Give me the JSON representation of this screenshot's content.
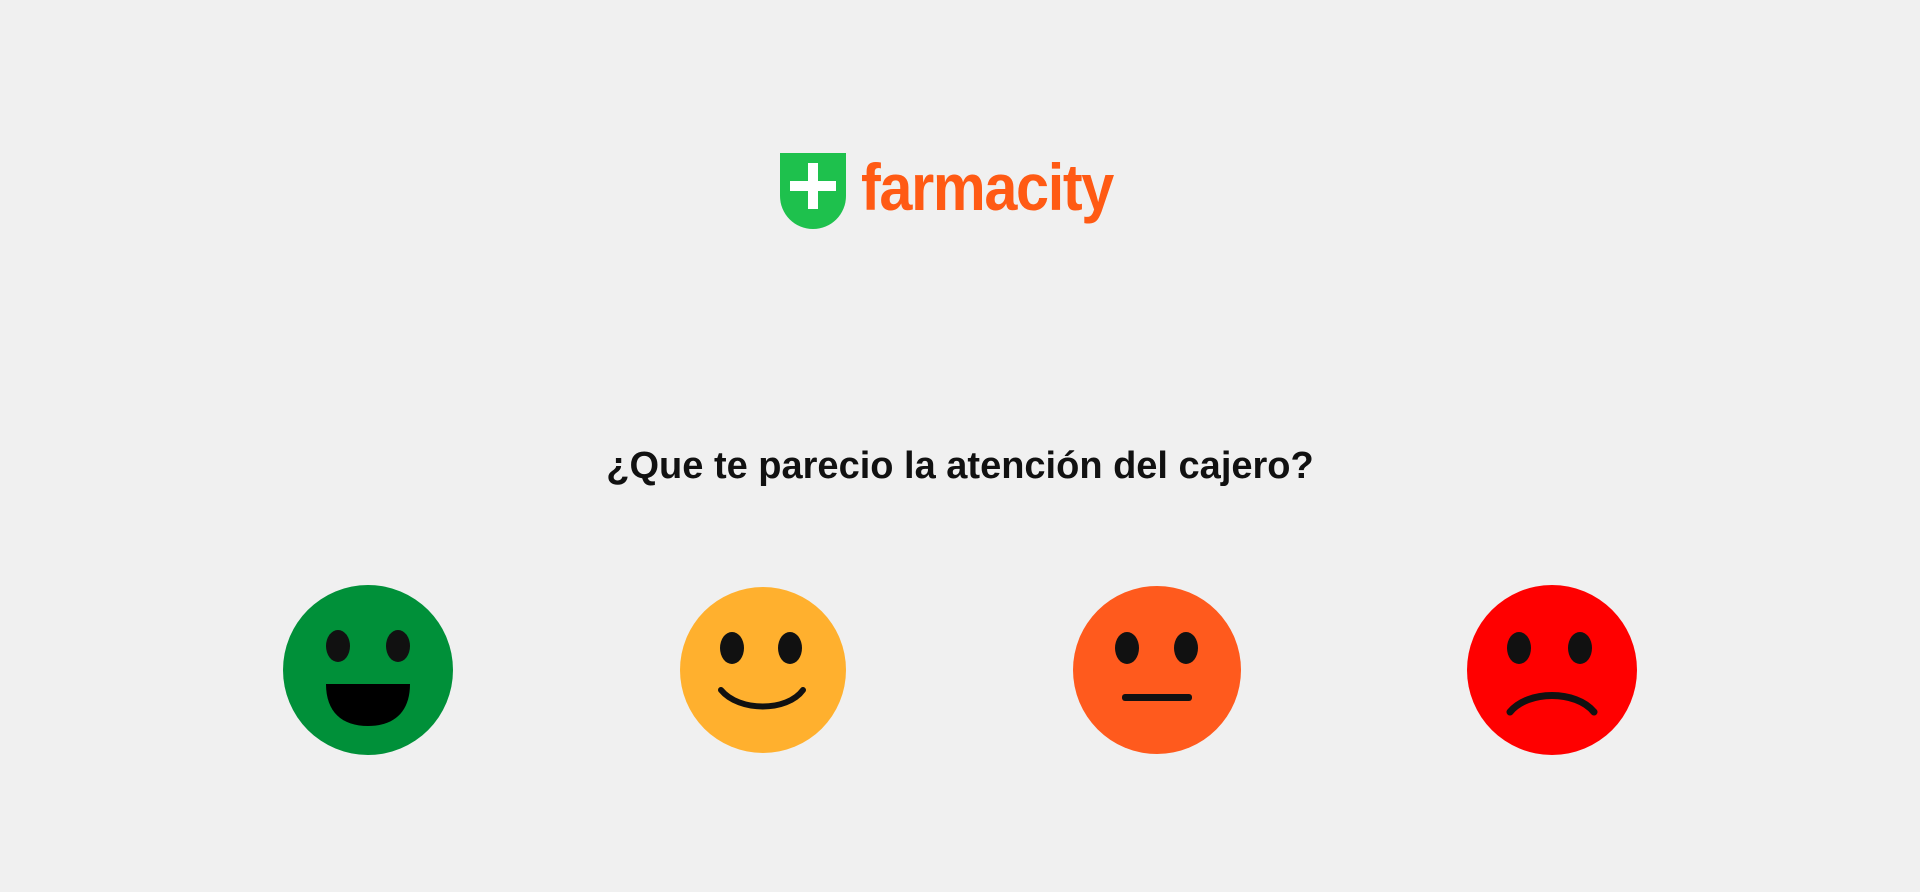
{
  "brand": {
    "name": "farmacity",
    "logo_icon": "plus-shield-icon",
    "colors": {
      "shield": "#1ec14d",
      "text": "#ff5a14"
    }
  },
  "survey": {
    "question": "¿Que te parecio la atención del cajero?",
    "options": [
      {
        "icon": "very-happy-face-icon",
        "color": "#009039"
      },
      {
        "icon": "happy-face-icon",
        "color": "#ffb02e"
      },
      {
        "icon": "neutral-face-icon",
        "color": "#ff5a1d"
      },
      {
        "icon": "sad-face-icon",
        "color": "#ff0000"
      }
    ]
  }
}
